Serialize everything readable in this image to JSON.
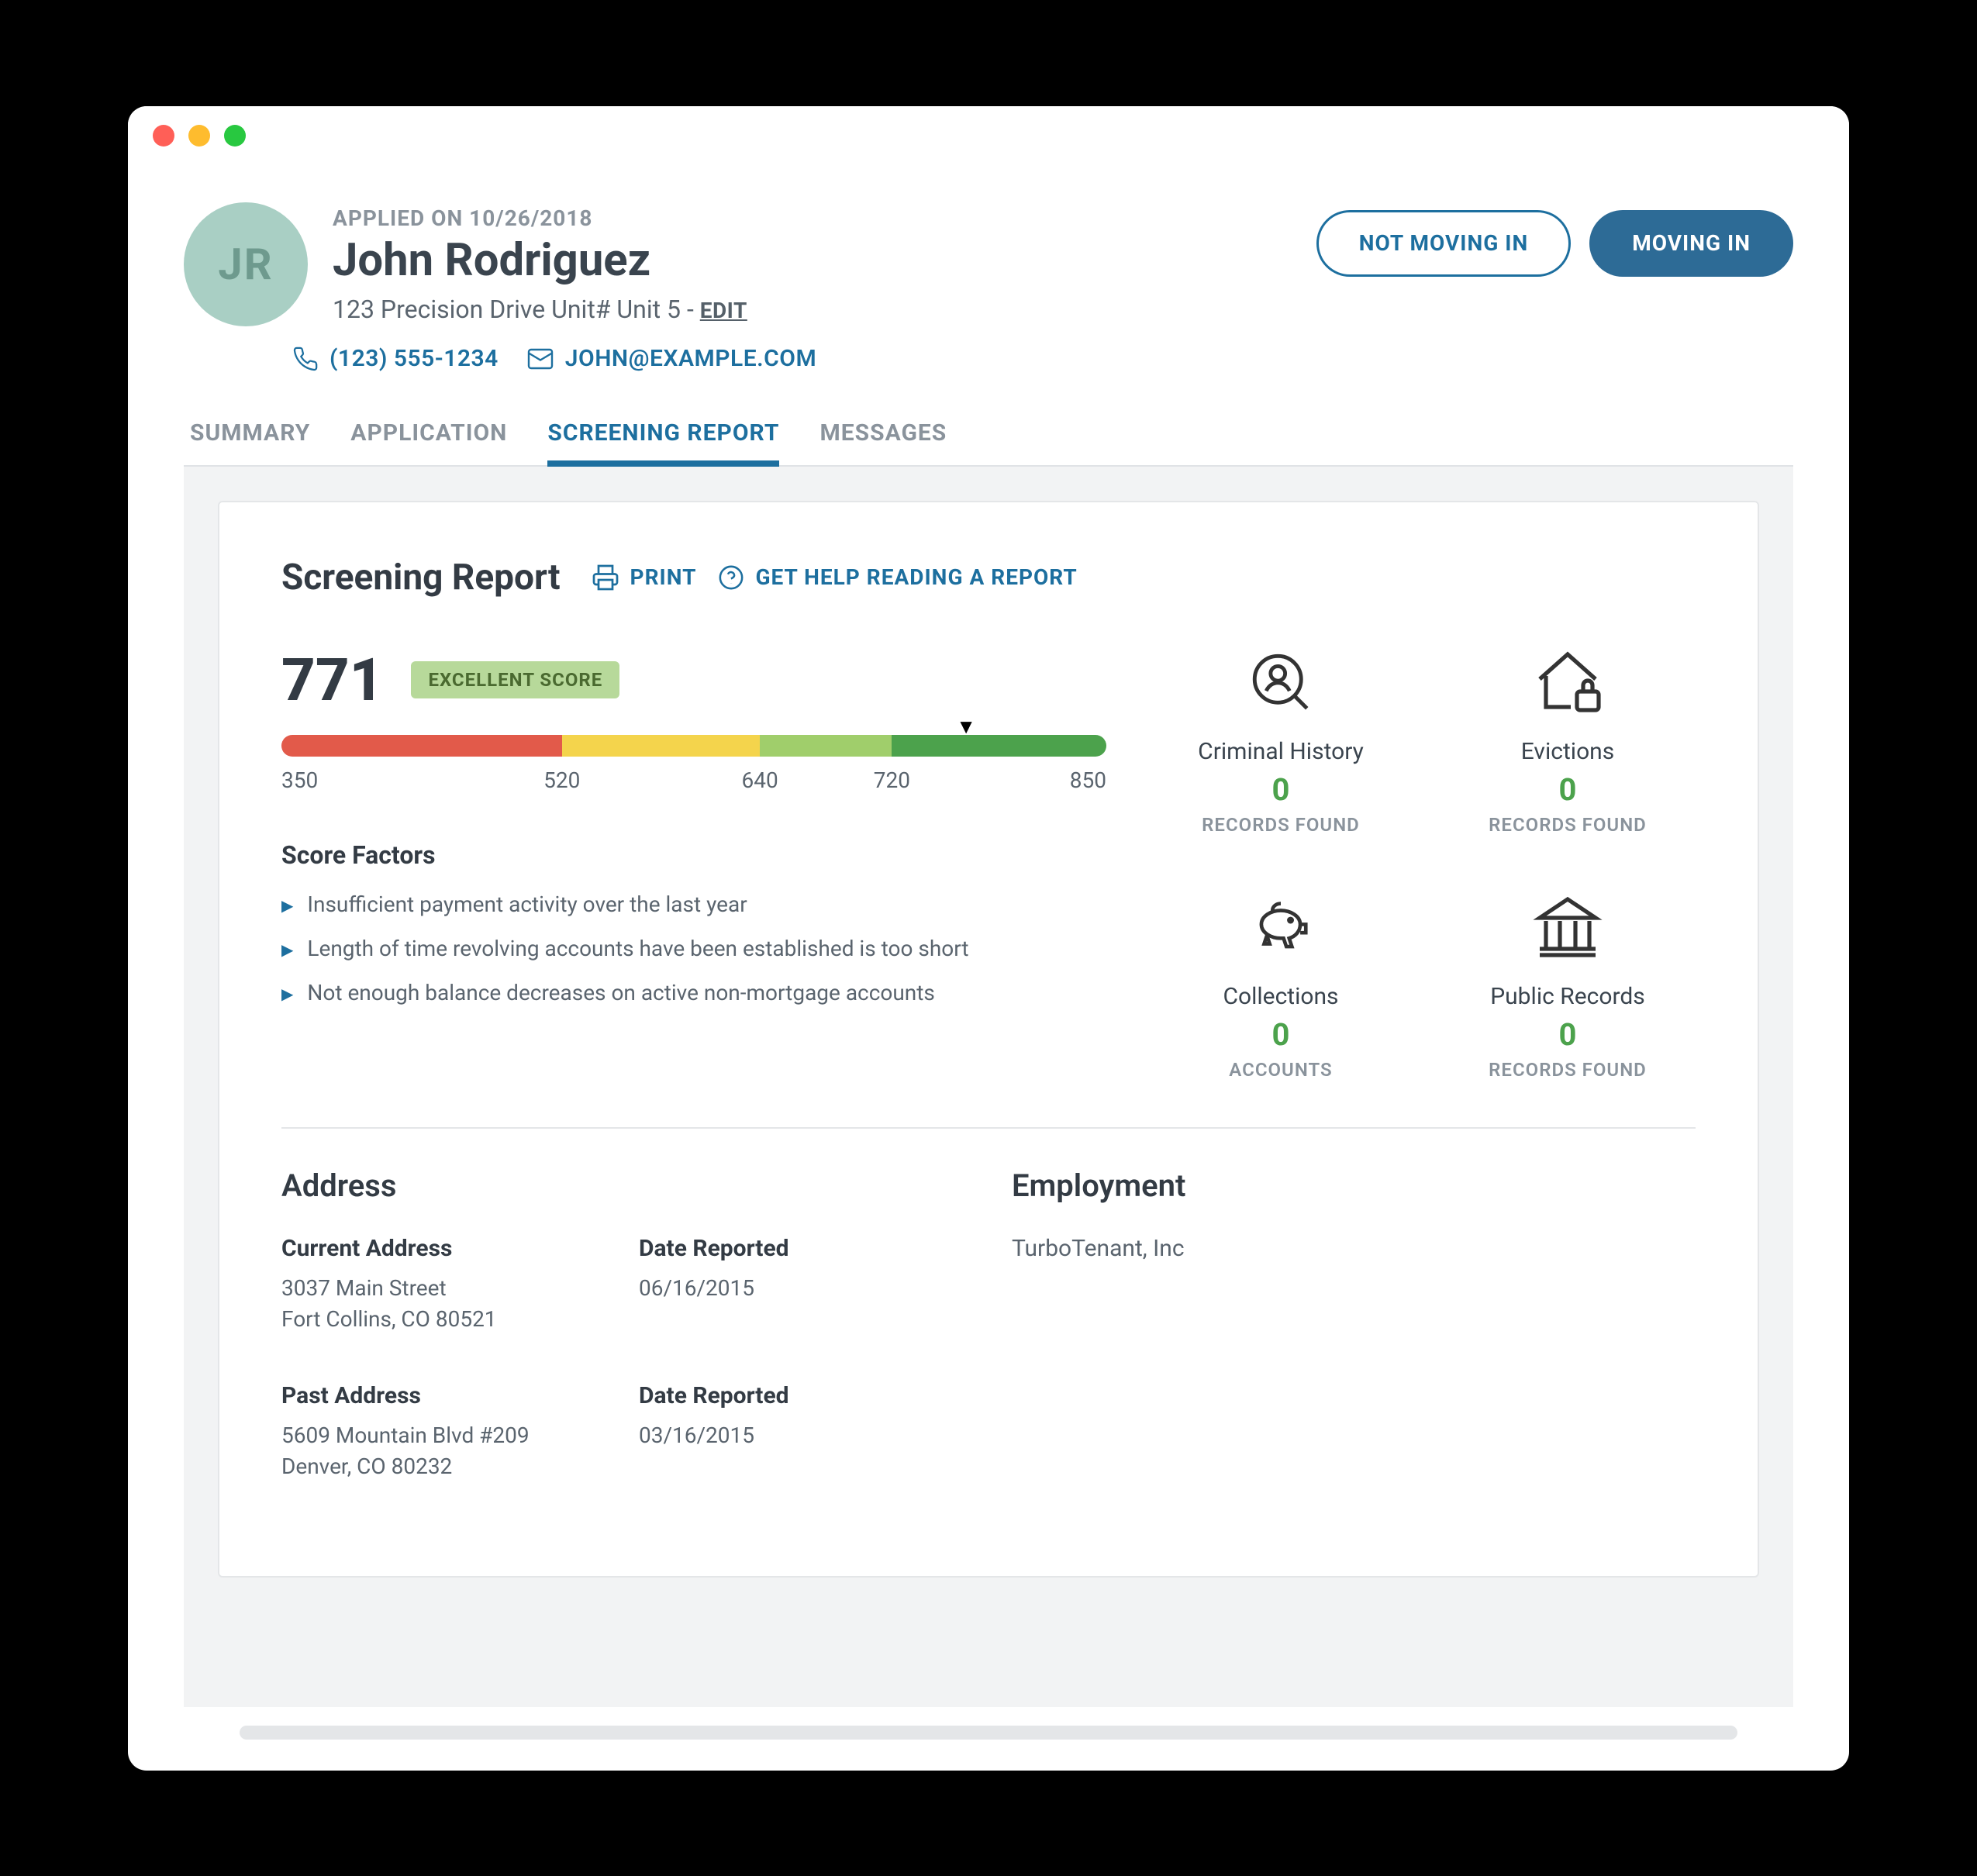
{
  "header": {
    "applied_on_label": "APPLIED ON 10/26/2018",
    "initials": "JR",
    "name": "John Rodriguez",
    "address": "123 Precision Drive Unit# Unit 5 - ",
    "edit_label": "EDIT",
    "phone": "(123) 555-1234",
    "email": "JOHN@EXAMPLE.COM",
    "not_moving_in_label": "NOT MOVING IN",
    "moving_in_label": "MOVING IN"
  },
  "tabs": {
    "summary": "SUMMARY",
    "application": "APPLICATION",
    "screening_report": "SCREENING REPORT",
    "messages": "MESSAGES"
  },
  "report": {
    "title": "Screening Report",
    "print_label": "PRINT",
    "help_label": "GET HELP READING A REPORT",
    "score": "771",
    "score_badge": "EXCELLENT SCORE",
    "gauge_ticks": {
      "t0": "350",
      "t1": "520",
      "t2": "640",
      "t3": "720",
      "t4": "850"
    },
    "factors_title": "Score Factors",
    "factors": {
      "0": "Insufficient payment activity over the last year",
      "1": "Length of time revolving accounts have been established is too short",
      "2": "Not enough balance decreases on active non-mortgage accounts"
    },
    "metrics": {
      "criminal": {
        "label": "Criminal History",
        "value": "0",
        "sub": "RECORDS FOUND"
      },
      "evictions": {
        "label": "Evictions",
        "value": "0",
        "sub": "RECORDS FOUND"
      },
      "collections": {
        "label": "Collections",
        "value": "0",
        "sub": "ACCOUNTS"
      },
      "public": {
        "label": "Public Records",
        "value": "0",
        "sub": "RECORDS FOUND"
      }
    }
  },
  "details": {
    "address_title": "Address",
    "employment_title": "Employment",
    "date_reported_label": "Date Reported",
    "current": {
      "label": "Current Address",
      "line1": "3037 Main Street",
      "line2": "Fort Collins, CO 80521",
      "date": "06/16/2015"
    },
    "past": {
      "label": "Past Address",
      "line1": "5609 Mountain Blvd #209",
      "line2": "Denver, CO 80232",
      "date": "03/16/2015"
    },
    "employment_value": "TurboTenant, Inc"
  }
}
